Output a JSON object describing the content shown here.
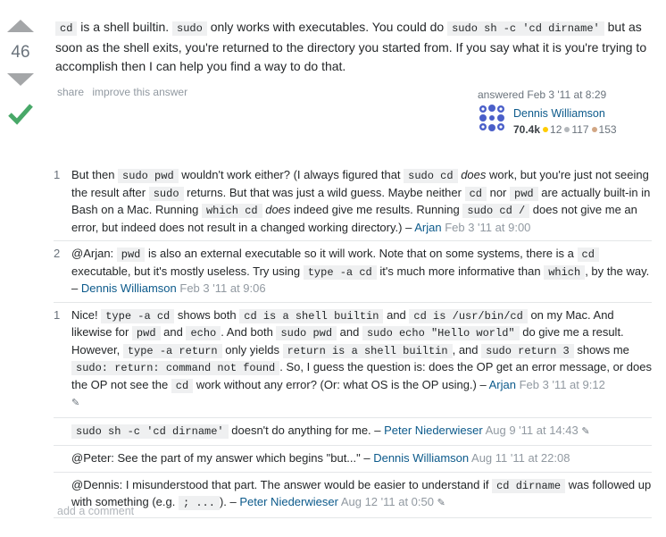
{
  "vote": {
    "score": "46"
  },
  "post": {
    "t1": " is a shell builtin. ",
    "c1": "cd",
    "c2": "sudo",
    "t2": " only works with executables. You could do ",
    "c3": "sudo sh -c 'cd dirname'",
    "t3": " but as soon as the shell exits, you're returned to the directory you started from. If you say what it is you're trying to accomplish then I can help you find a way to do that."
  },
  "actions": {
    "share": "share",
    "improve": "improve this answer"
  },
  "signature": {
    "answered": "answered Feb 3 '11 at 8:29",
    "username": "Dennis Williamson",
    "rep": "70.4k",
    "gold": "12",
    "silver": "117",
    "bronze": "153",
    "colors": {
      "gold": "#ffcc01",
      "silver": "#b4b8bc",
      "bronze": "#d1a684"
    }
  },
  "comments": [
    {
      "score": "1",
      "parts": [
        "But then ",
        "sudo pwd",
        " wouldn't work either? (I always figured that ",
        "sudo cd",
        " ",
        "does",
        " work, but you're just not seeing the result after ",
        "sudo",
        " returns. But that was just a wild guess. Maybe neither ",
        "cd",
        " nor ",
        "pwd",
        " are actually built-in in Bash on a Mac. Running ",
        "which cd",
        " ",
        "does",
        " indeed give me results. Running ",
        "sudo cd /",
        " does not give me an error, but indeed does not result in a changed working directory.) – "
      ],
      "user": "Arjan",
      "date": "Feb 3 '11 at 9:00"
    },
    {
      "score": "2",
      "parts": [
        "@Arjan: ",
        "pwd",
        " is also an external executable so it will work. Note that on some systems, there is a ",
        "cd",
        " executable, but it's mostly useless. Try using ",
        "type -a cd",
        " it's much more informative than ",
        "which",
        ", by the way. – "
      ],
      "user": "Dennis Williamson",
      "date": "Feb 3 '11 at 9:06"
    },
    {
      "score": "1",
      "parts": [
        "Nice! ",
        "type -a cd",
        " shows both ",
        "cd is a shell builtin",
        " and ",
        "cd is /usr/bin/cd",
        " on my Mac. And likewise for ",
        "pwd",
        " and ",
        "echo",
        ". And both ",
        "sudo pwd",
        " and ",
        "sudo echo \"Hello world\"",
        " do give me a result. However, ",
        "type -a return",
        " only yields ",
        "return is a shell builtin",
        ", and ",
        "sudo return 3",
        " shows me ",
        "sudo: return: command not found",
        ". So, I guess the question is: does the OP get an error message, or does the OP not see the ",
        "cd",
        " work without any error? (Or: what OS is the OP using.) – "
      ],
      "user": "Arjan",
      "date": "Feb 3 '11 at 9:12"
    },
    {
      "score": "",
      "parts": [
        "sudo sh -c 'cd dirname'",
        " doesn't do anything for me. – "
      ],
      "user": "Peter Niederwieser",
      "date": "Aug 9 '11 at 14:43"
    },
    {
      "score": "",
      "parts": [
        "@Peter: See the part of my answer which begins \"but...\" – "
      ],
      "user": "Dennis Williamson",
      "date": "Aug 11 '11 at 22:08"
    },
    {
      "score": "",
      "parts": [
        "@Dennis: I misunderstood that part. The answer would be easier to understand if ",
        "cd dirname",
        " was followed up with something (e.g. ",
        "; ...",
        "). – "
      ],
      "user": "Peter Niederwieser",
      "date": "Aug 12 '11 at 0:50"
    }
  ],
  "add_comment": "add a comment",
  "icons": [
    "arrow-up-icon",
    "arrow-down-icon",
    "accepted-check-icon",
    "pencil-icon",
    "avatar-identicon"
  ]
}
